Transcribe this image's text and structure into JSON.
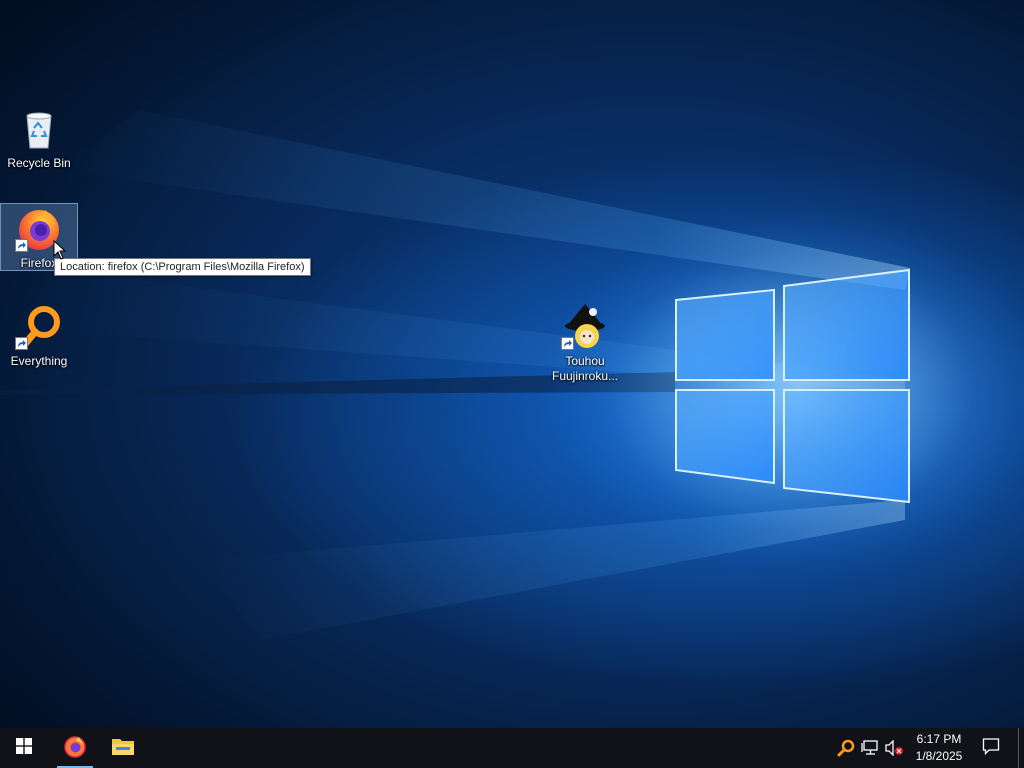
{
  "desktop": {
    "icons": [
      {
        "label": "Recycle Bin",
        "icon": "recycle-bin-icon"
      },
      {
        "label": "Firefox",
        "icon": "firefox-icon",
        "selected": true
      },
      {
        "label": "Everything",
        "icon": "everything-search-icon"
      },
      {
        "label": "Touhou Fuujinroku...",
        "icon": "touhou-game-icon"
      }
    ],
    "tooltip": "Location: firefox (C:\\Program Files\\Mozilla Firefox)"
  },
  "taskbar": {
    "start_icon": "windows-start-icon",
    "pinned": [
      {
        "name": "Firefox",
        "icon": "firefox-icon",
        "active": true
      },
      {
        "name": "File Explorer",
        "icon": "folder-icon",
        "active": false
      }
    ],
    "tray": {
      "icons": [
        "everything-tray-icon",
        "network-icon",
        "volume-muted-icon"
      ],
      "time": "6:17 PM",
      "date": "1/8/2025",
      "notification_icon": "action-center-icon"
    }
  },
  "colors": {
    "wallpaper_dark": "#03152f",
    "wallpaper_light": "#1e78dc",
    "taskbar": "#101218",
    "accent": "#76b9ed"
  }
}
